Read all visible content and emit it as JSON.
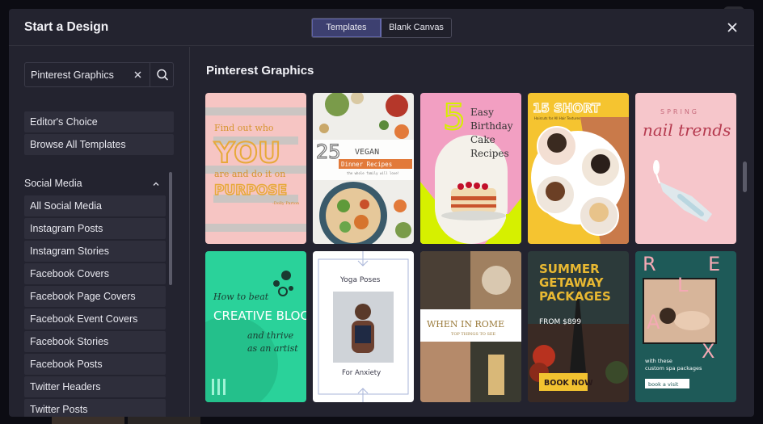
{
  "modal": {
    "title": "Start a Design",
    "tabs": [
      {
        "label": "Templates",
        "active": true
      },
      {
        "label": "Blank Canvas",
        "active": false
      }
    ]
  },
  "sidebar": {
    "search": {
      "value": "Pinterest Graphics"
    },
    "quick_links": [
      "Editor's Choice",
      "Browse All Templates"
    ],
    "section": {
      "label": "Social Media",
      "expanded": true
    },
    "categories": [
      "All Social Media",
      "Instagram Posts",
      "Instagram Stories",
      "Facebook Covers",
      "Facebook Page Covers",
      "Facebook Event Covers",
      "Facebook Stories",
      "Facebook Posts",
      "Twitter Headers",
      "Twitter Posts"
    ]
  },
  "content": {
    "heading": "Pinterest Graphics",
    "templates": [
      {
        "name": "find-out-who-you-are",
        "lines": [
          "Find out who",
          "YOU",
          "are and do it on",
          "PURPOSE",
          "-Dolly Parton"
        ]
      },
      {
        "name": "25-vegan-dinner-recipes",
        "lines": [
          "25",
          "VEGAN",
          "Dinner Recipes",
          "the whole family will love!"
        ]
      },
      {
        "name": "5-easy-birthday-cake-recipes",
        "lines": [
          "5",
          "Easy",
          "Birthday",
          "Cake",
          "Recipes"
        ]
      },
      {
        "name": "15-short-haircuts",
        "lines": [
          "15 SHORT",
          "Haircuts for All Hair Textures"
        ]
      },
      {
        "name": "spring-nail-trends",
        "lines": [
          "SPRING",
          "nail trends"
        ]
      },
      {
        "name": "creative-block",
        "lines": [
          "How to beat",
          "CREATIVE BLOCK",
          "and thrive",
          "as an artist"
        ]
      },
      {
        "name": "yoga-poses-for-anxiety",
        "lines": [
          "Yoga Poses",
          "For Anxiety"
        ]
      },
      {
        "name": "when-in-rome",
        "lines": [
          "WHEN IN ROME",
          "TOP THINGS TO SEE"
        ]
      },
      {
        "name": "summer-getaway-packages",
        "lines": [
          "SUMMER",
          "GETAWAY",
          "PACKAGES",
          "FROM $899",
          "BOOK NOW"
        ]
      },
      {
        "name": "relax-spa-packages",
        "lines": [
          "R",
          "E",
          "L",
          "A",
          "X",
          "with these",
          "custom spa packages",
          "book a visit"
        ]
      }
    ]
  },
  "colors": {
    "modal_bg": "#23232f",
    "sidebar_item_bg": "#2e2e3b",
    "active_tab": "#3d4070"
  }
}
